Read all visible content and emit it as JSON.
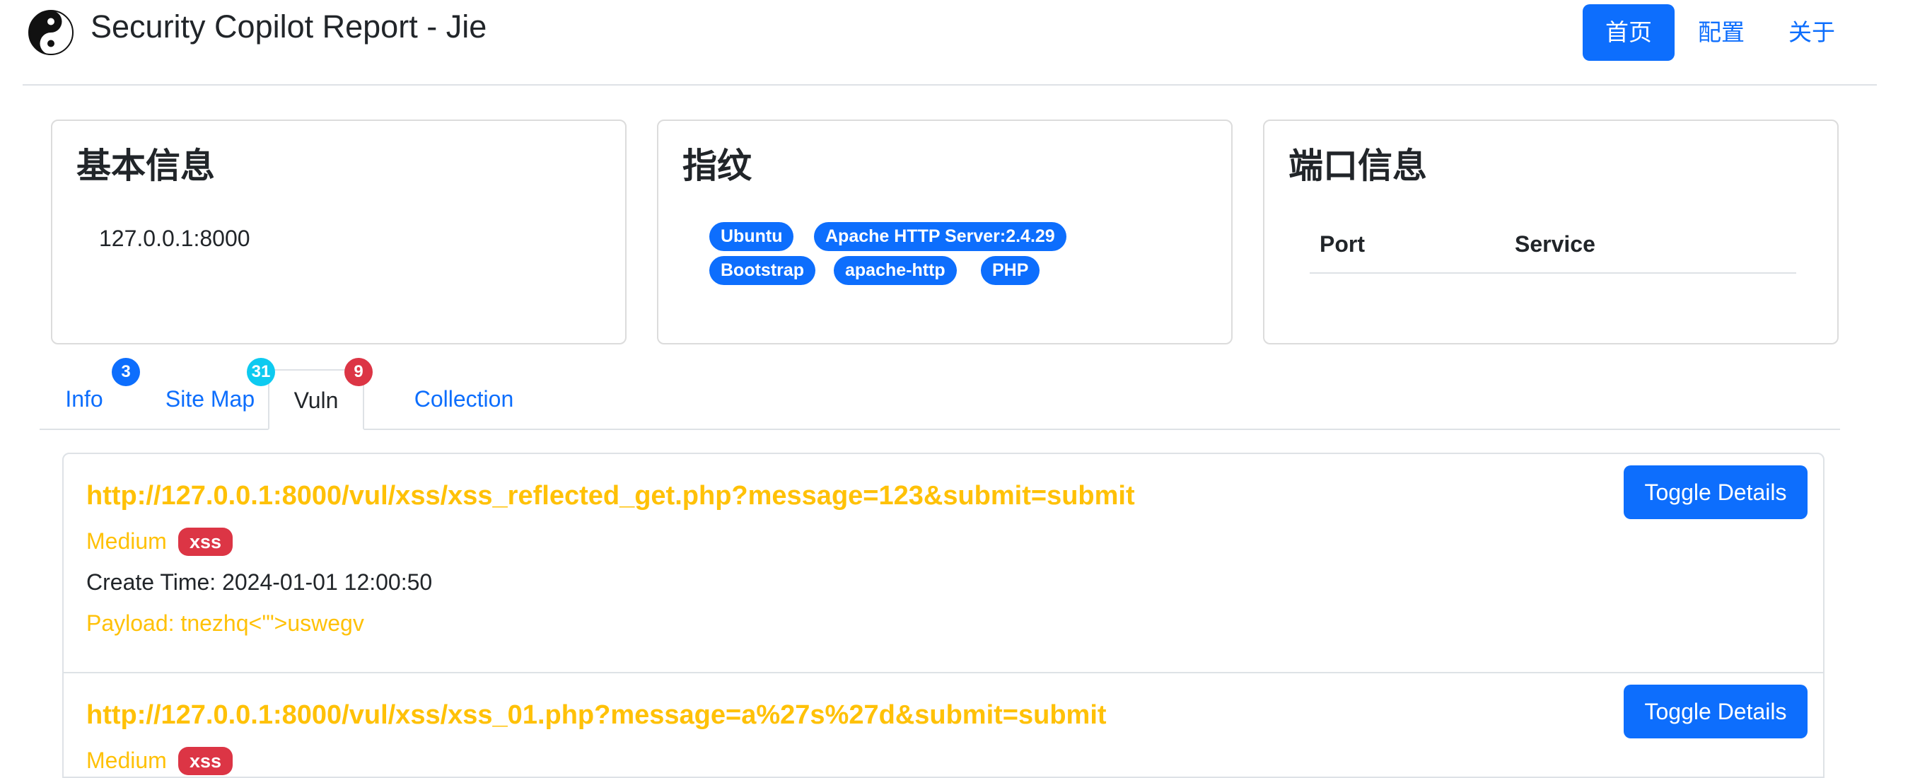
{
  "header": {
    "title": "Security Copilot Report - Jie",
    "logo_icon": "yin-yang-icon",
    "nav": [
      {
        "label": "首页",
        "active": true
      },
      {
        "label": "配置",
        "active": false
      },
      {
        "label": "关于",
        "active": false
      }
    ]
  },
  "cards": {
    "basic": {
      "title": "基本信息",
      "value": "127.0.0.1:8000"
    },
    "fingerprint": {
      "title": "指纹",
      "tags": [
        "Ubuntu",
        "Apache HTTP Server:2.4.29",
        "Bootstrap",
        "apache-http",
        "PHP"
      ]
    },
    "ports": {
      "title": "端口信息",
      "columns": [
        "Port",
        "Service"
      ],
      "rows": []
    }
  },
  "tabs": [
    {
      "label": "Info",
      "count": "3",
      "count_color": "#0d6efd",
      "active": false
    },
    {
      "label": "Site Map",
      "count": "31",
      "count_color": "#0dcaf0",
      "active": false
    },
    {
      "label": "Vuln",
      "count": "9",
      "count_color": "#dc3545",
      "active": true
    },
    {
      "label": "Collection",
      "count": null,
      "active": false
    }
  ],
  "vulns": [
    {
      "url": "http://127.0.0.1:8000/vul/xss/xss_reflected_get.php?message=123&submit=submit",
      "severity": "Medium",
      "type": "xss",
      "create_time": "Create Time: 2024-01-01 12:00:50",
      "payload": "Payload: tnezhq<'\">uswegv",
      "toggle_label": "Toggle Details"
    },
    {
      "url": "http://127.0.0.1:8000/vul/xss/xss_01.php?message=a%27s%27d&submit=submit",
      "severity": "Medium",
      "type": "xss",
      "toggle_label": "Toggle Details"
    }
  ],
  "colors": {
    "primary": "#0d6efd",
    "warning": "#ffc107",
    "danger": "#dc3545",
    "info": "#0dcaf0"
  }
}
